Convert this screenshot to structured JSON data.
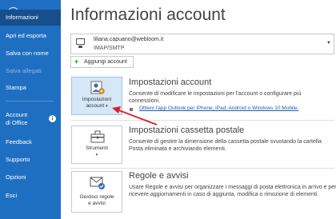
{
  "sidebar": {
    "items": [
      {
        "label": "Informazioni"
      },
      {
        "label": "Apri ed esporta"
      },
      {
        "label": "Salva con nome"
      },
      {
        "label": "Salva allegati"
      },
      {
        "label": "Stampa"
      },
      {
        "label": "Account"
      },
      {
        "label": "di Office"
      },
      {
        "label": "Feedback"
      },
      {
        "label": "Supporto"
      },
      {
        "label": "Opzioni"
      },
      {
        "label": "Esci"
      }
    ],
    "colors": {
      "background": "#1e6fc1",
      "active": "#164f8c"
    }
  },
  "main": {
    "title": "Informazioni account",
    "account": {
      "email": "liliana.capuano@webloom.it",
      "type": "IMAP/SMTP"
    },
    "add_account_label": "Aggiungi account",
    "sections": [
      {
        "tile_label_1": "Impostazioni",
        "tile_label_2": "account",
        "title": "Impostazioni account",
        "desc_1": "Consente di modificare le impostazioni per l'account o configurare più",
        "desc_2": "connessioni.",
        "link": "Ottieni l'app Outlook per iPhone, iPad, Android o Windows 10 Mobile."
      },
      {
        "tile_label_1": "Strumenti",
        "title": "Impostazioni cassetta postale",
        "desc_1": "Consente di gestire la dimensione della cassetta postale svuotando la cartella",
        "desc_2": "Posta eliminata e archiviando elementi."
      },
      {
        "tile_label_1": "Gestisci regole",
        "tile_label_2": "e avvisi",
        "title": "Regole e avvisi",
        "desc_1": "Usare Regole e avvisi per organizzare i messaggi di posta elettronica in arrivo e per",
        "desc_2": "ricevere aggiornamenti in caso di aggiunta, modifica o rimozione di elementi."
      }
    ]
  }
}
